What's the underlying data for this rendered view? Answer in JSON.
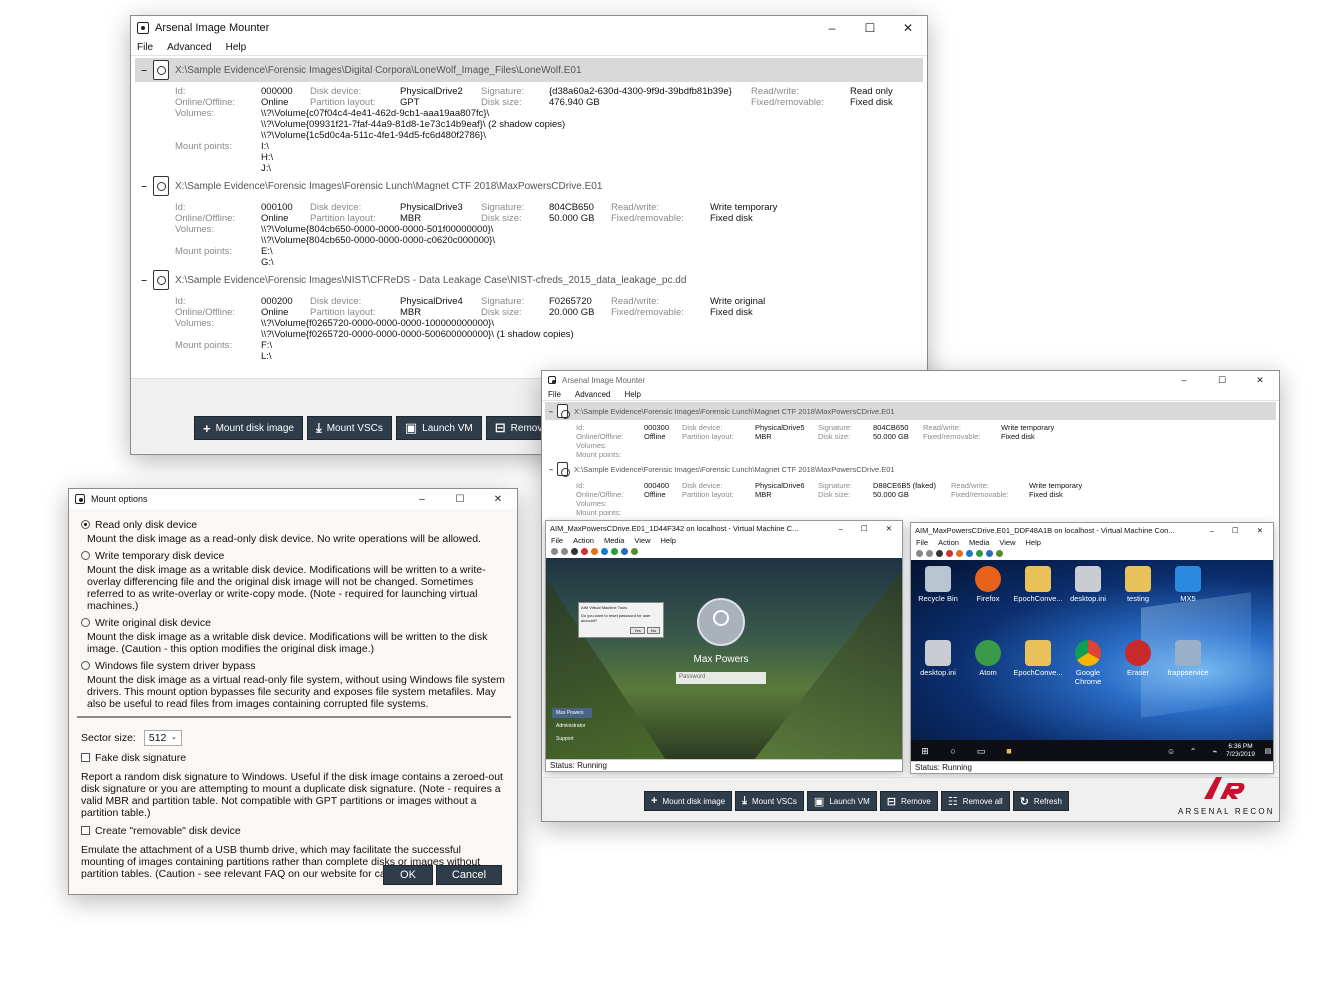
{
  "main_window": {
    "title": "Arsenal Image Mounter",
    "menu": [
      "File",
      "Advanced",
      "Help"
    ],
    "disks": [
      {
        "path": "X:\\Sample Evidence\\Forensic Images\\Digital Corpora\\LoneWolf_Image_Files\\LoneWolf.E01",
        "id": "000000",
        "online": "Online",
        "disk_device": "PhysicalDrive2",
        "partition_layout": "GPT",
        "signature": "{d38a60a2-630d-4300-9f9d-39bdfb81b39e}",
        "disk_size": "476.940 GB",
        "read_write": "Read only",
        "fixed_removable": "Fixed disk",
        "volumes": [
          "\\\\?\\Volume{c07f04c4-4e41-462d-9cb1-aaa19aa807fc}\\",
          "\\\\?\\Volume{09931f21-7faf-44a9-81d8-1e73c14b9eaf}\\ (2 shadow copies)",
          "\\\\?\\Volume{1c5d0c4a-511c-4fe1-94d5-fc6d480f2786}\\"
        ],
        "mount_points": [
          "I:\\",
          "H:\\",
          "J:\\"
        ]
      },
      {
        "path": "X:\\Sample Evidence\\Forensic Images\\Forensic Lunch\\Magnet CTF 2018\\MaxPowersCDrive.E01",
        "id": "000100",
        "online": "Online",
        "disk_device": "PhysicalDrive3",
        "partition_layout": "MBR",
        "signature": "804CB650",
        "disk_size": "50.000 GB",
        "read_write": "Write temporary",
        "fixed_removable": "Fixed disk",
        "volumes": [
          "\\\\?\\Volume{804cb650-0000-0000-0000-501f00000000}\\",
          "\\\\?\\Volume{804cb650-0000-0000-0000-c0620c000000}\\"
        ],
        "mount_points": [
          "E:\\",
          "G:\\"
        ]
      },
      {
        "path": "X:\\Sample Evidence\\Forensic Images\\NIST\\CFReDS - Data Leakage Case\\NIST-cfreds_2015_data_leakage_pc.dd",
        "id": "000200",
        "online": "Online",
        "disk_device": "PhysicalDrive4",
        "partition_layout": "MBR",
        "signature": "F0265720",
        "disk_size": "20.000 GB",
        "read_write": "Write original",
        "fixed_removable": "Fixed disk",
        "volumes": [
          "\\\\?\\Volume{f0265720-0000-0000-0000-100000000000}\\",
          "\\\\?\\Volume{f0265720-0000-0000-0000-500600000000}\\ (1 shadow copies)"
        ],
        "mount_points": [
          "F:\\",
          "L:\\"
        ]
      }
    ],
    "labels": {
      "id": "Id:",
      "online": "Online/Offline:",
      "volumes": "Volumes:",
      "mount_points": "Mount points:",
      "disk_device": "Disk device:",
      "partition_layout": "Partition layout:",
      "signature": "Signature:",
      "disk_size": "Disk size:",
      "read_write": "Read/write:",
      "fixed_removable": "Fixed/removable:"
    },
    "buttons": {
      "mount": "Mount disk image",
      "vscs": "Mount VSCs",
      "launch": "Launch VM",
      "remove": "Remov"
    }
  },
  "second_window": {
    "title": "Arsenal Image Mounter",
    "menu": [
      "File",
      "Advanced",
      "Help"
    ],
    "disks": [
      {
        "path": "X:\\Sample Evidence\\Forensic Images\\Forensic Lunch\\Magnet CTF 2018\\MaxPowersCDrive.E01",
        "id": "000300",
        "online": "Offline",
        "disk_device": "PhysicalDrive5",
        "partition_layout": "MBR",
        "signature": "804CB650",
        "disk_size": "50.000 GB",
        "read_write": "Write temporary",
        "fixed_removable": "Fixed disk"
      },
      {
        "path": "X:\\Sample Evidence\\Forensic Images\\Forensic Lunch\\Magnet CTF 2018\\MaxPowersCDrive.E01",
        "id": "000400",
        "online": "Offline",
        "disk_device": "PhysicalDrive6",
        "partition_layout": "MBR",
        "signature": "D88CE6B5 (faked)",
        "disk_size": "50.000 GB",
        "read_write": "Write temporary",
        "fixed_removable": "Fixed disk"
      }
    ],
    "buttons": {
      "mount": "Mount disk image",
      "vscs": "Mount VSCs",
      "launch": "Launch VM",
      "remove": "Remove",
      "remove_all": "Remove all",
      "refresh": "Refresh"
    },
    "brand": "ARSENAL RECON",
    "vm1": {
      "title": "AIM_MaxPowersCDrive.E01_1D44F342 on localhost - Virtual Machine C...",
      "menu": [
        "File",
        "Action",
        "Media",
        "View",
        "Help"
      ],
      "user": "Max Powers",
      "password_placeholder": "Password",
      "dialog_title": "AIM Virtual Machine Tools",
      "dialog_text": "Do you want to reset password for user account?",
      "dialog_yes": "Yes",
      "dialog_no": "No",
      "status": "Status: Running",
      "users": [
        "Max Powers",
        "Administrator",
        "Support"
      ]
    },
    "vm2": {
      "title": "AIM_MaxPowersCDrive.E01_DDF48A1B on localhost - Virtual Machine Con...",
      "menu": [
        "File",
        "Action",
        "Media",
        "View",
        "Help"
      ],
      "icons": [
        "Recycle Bin",
        "Firefox",
        "EpochConve...",
        "desktop.ini",
        "testing",
        "MX5",
        "desktop.ini",
        "Atom",
        "EpochConve...",
        "Google Chrome",
        "Eraser",
        "frappservice"
      ],
      "time": "6:36 PM",
      "date": "7/23/2019",
      "status": "Status: Running"
    }
  },
  "dialog": {
    "title": "Mount options",
    "options": [
      {
        "label": "Read only disk device",
        "desc": "Mount the disk image as a read-only disk device. No write operations will be allowed."
      },
      {
        "label": "Write temporary disk device",
        "desc": "Mount the disk image as a writable disk device. Modifications will be written to a write-overlay differencing file and the original disk image will not be changed. Sometimes referred to as write-overlay or write-copy mode. (Note - required for launching virtual machines.)"
      },
      {
        "label": "Write original disk device",
        "desc": "Mount the disk image as a writable disk device. Modifications will be written to the disk image. (Caution - this option modifies the original disk image.)"
      },
      {
        "label": "Windows file system driver bypass",
        "desc": "Mount the disk image as a virtual read-only file system, without using Windows file system drivers. This mount option bypasses file security and exposes file system metafiles. May also be useful to read files from images containing corrupted file systems."
      }
    ],
    "sector_size_label": "Sector size:",
    "sector_size_value": "512",
    "fake_sig_label": "Fake disk signature",
    "fake_sig_desc": "Report a random disk signature to Windows. Useful if the disk image contains a zeroed-out disk signature or you are attempting to mount a duplicate disk signature. (Note - requires a valid MBR and partition table. Not compatible with GPT partitions or images without a partition table.)",
    "removable_label": "Create \"removable\" disk device",
    "removable_desc": "Emulate the attachment of a USB thumb drive, which may facilitate the successful mounting of images containing partitions rather than complete disks or images without partition tables. (Caution - see relevant FAQ on our website for caveats.)",
    "ok": "OK",
    "cancel": "Cancel"
  },
  "colors": {
    "button_bg": "#2f3d4a",
    "brand_red": "#c8102e",
    "header_grey": "#d9d9d9"
  }
}
